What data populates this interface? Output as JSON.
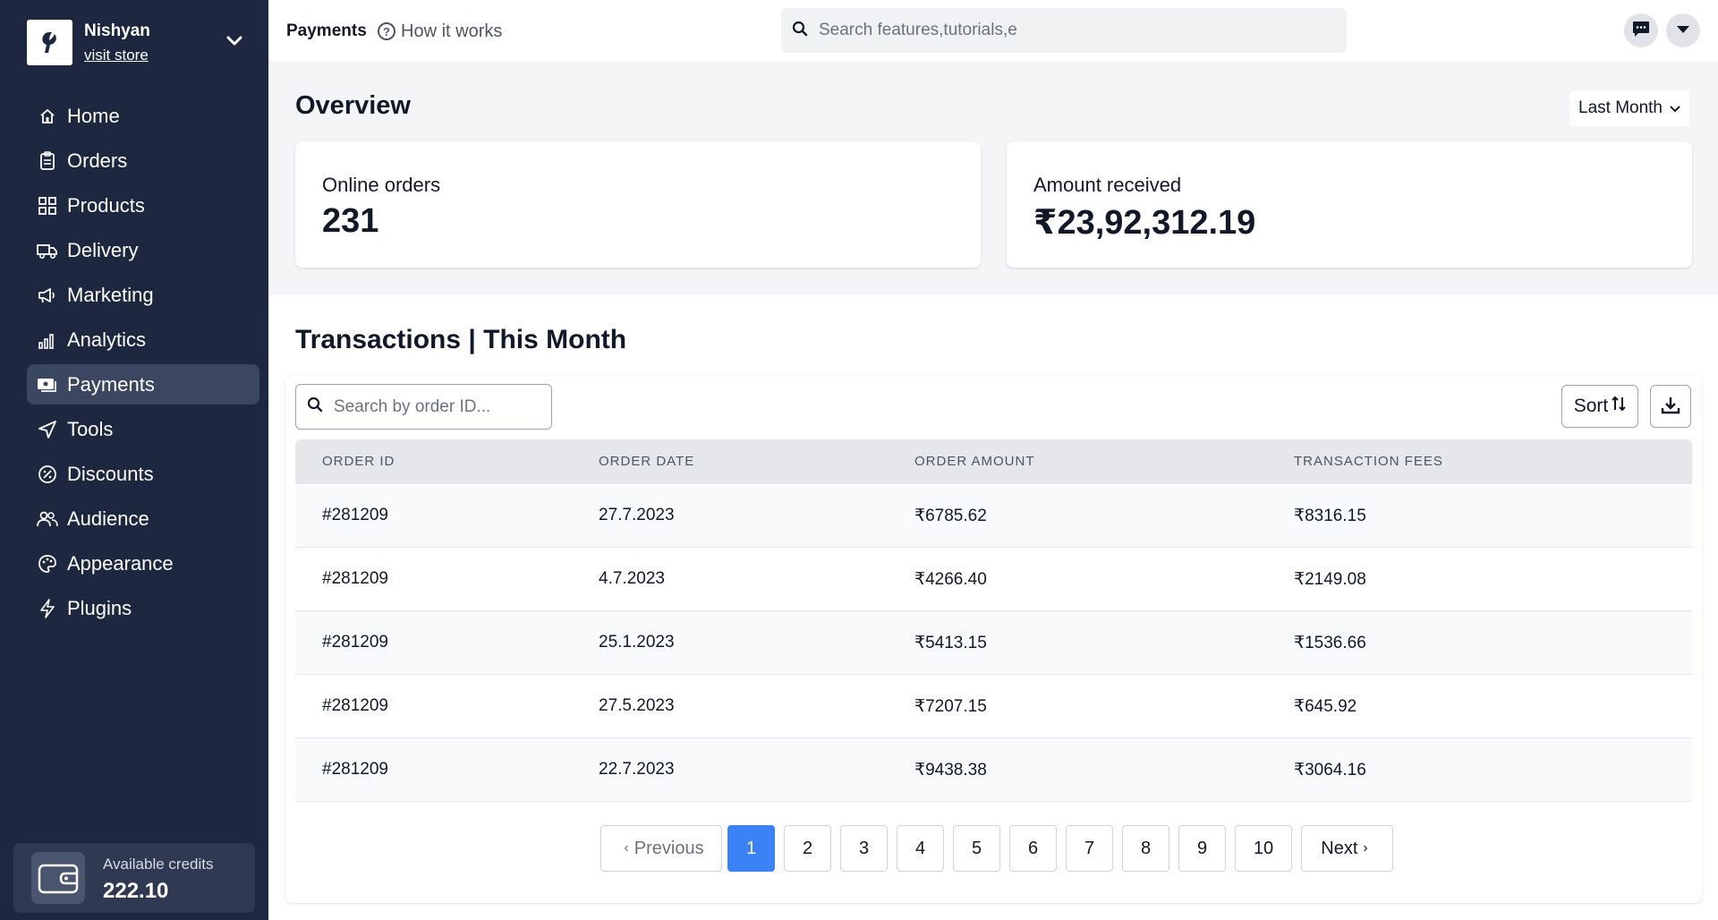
{
  "sidebar": {
    "store_name": "Nishyan",
    "store_link": "visit store",
    "items": [
      {
        "label": "Home",
        "icon": "home-icon"
      },
      {
        "label": "Orders",
        "icon": "clipboard-icon"
      },
      {
        "label": "Products",
        "icon": "grid-icon"
      },
      {
        "label": "Delivery",
        "icon": "truck-icon"
      },
      {
        "label": "Marketing",
        "icon": "megaphone-icon"
      },
      {
        "label": "Analytics",
        "icon": "bar-chart-icon"
      },
      {
        "label": "Payments",
        "icon": "payments-icon",
        "active": true
      },
      {
        "label": "Tools",
        "icon": "send-icon"
      },
      {
        "label": "Discounts",
        "icon": "discount-icon"
      },
      {
        "label": "Audience",
        "icon": "users-icon"
      },
      {
        "label": "Appearance",
        "icon": "palette-icon"
      },
      {
        "label": "Plugins",
        "icon": "bolt-icon"
      }
    ],
    "credits": {
      "label": "Available credits",
      "value": "222.10",
      "icon": "wallet-icon"
    }
  },
  "topbar": {
    "page_name": "Payments",
    "help_link": "How it works",
    "search_placeholder": "Search features,tutorials,e"
  },
  "overview": {
    "title": "Overview",
    "range": "Last Month",
    "cards": [
      {
        "label": "Online orders",
        "value": "231"
      },
      {
        "label": "Amount received",
        "value": "₹23,92,312.19"
      }
    ]
  },
  "transactions": {
    "title": "Transactions | This Month",
    "search_placeholder": "Search by order ID...",
    "sort_label": "Sort",
    "columns": [
      "ORDER ID",
      "ORDER DATE",
      "ORDER AMOUNT",
      "TRANSACTION FEES"
    ],
    "rows": [
      [
        "#281209",
        "27.7.2023",
        "₹6785.62",
        "₹8316.15"
      ],
      [
        "#281209",
        "4.7.2023",
        "₹4266.40",
        "₹2149.08"
      ],
      [
        "#281209",
        "25.1.2023",
        "₹5413.15",
        "₹1536.66"
      ],
      [
        "#281209",
        "27.5.2023",
        "₹7207.15",
        "₹645.92"
      ],
      [
        "#281209",
        "22.7.2023",
        "₹9438.38",
        "₹3064.16"
      ]
    ]
  },
  "pagination": {
    "previous": "Previous",
    "next": "Next",
    "pages": [
      "1",
      "2",
      "3",
      "4",
      "5",
      "6",
      "7",
      "8",
      "9",
      "10"
    ],
    "current": "1"
  },
  "colors": {
    "sidebar_bg": "#1d2740",
    "active_item": "#3b4761",
    "accent": "#3b82f6"
  }
}
